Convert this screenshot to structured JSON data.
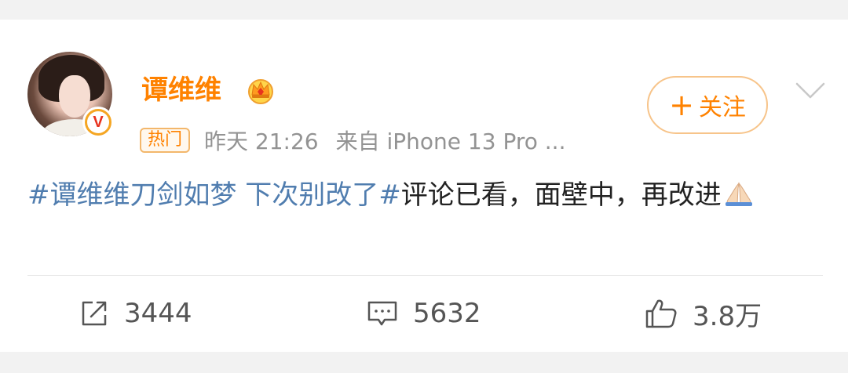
{
  "user": {
    "name": "谭维维",
    "verify_mark": "V",
    "crown_icon": "crown-icon"
  },
  "follow_button": {
    "plus": "+",
    "label": "关注"
  },
  "meta": {
    "badge": "热门",
    "time": "昨天 21:26",
    "source": "来自 iPhone 13 Pro ..."
  },
  "post": {
    "topic1": "#谭维维刀剑如梦 下次别改了#",
    "text": "评论已看，面壁中，再改进"
  },
  "actions": {
    "repost_count": "3444",
    "comment_count": "5632",
    "like_count": "3.8万"
  },
  "colors": {
    "accent": "#ff8200",
    "topic": "#507daf",
    "text": "#222222",
    "meta": "#939393"
  }
}
